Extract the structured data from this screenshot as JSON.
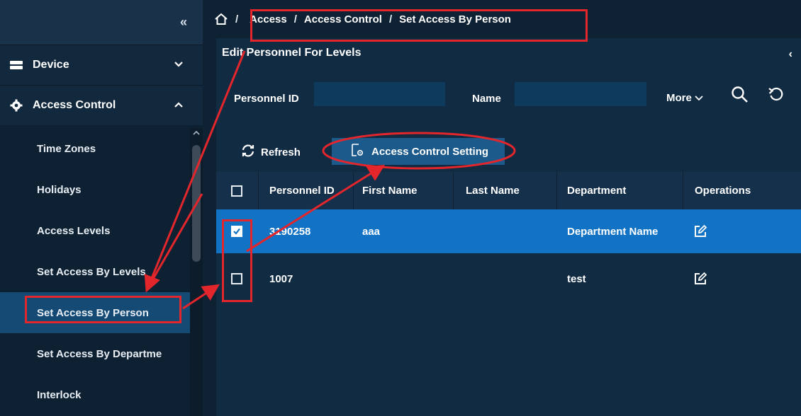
{
  "sidebar": {
    "collapse_glyph": "«",
    "groups": [
      {
        "label": "Device",
        "icon": "device-icon",
        "chevron": "˅"
      },
      {
        "label": "Access Control",
        "icon": "gear-icon",
        "chevron": "˄"
      }
    ],
    "items": [
      {
        "label": "Time Zones"
      },
      {
        "label": "Holidays"
      },
      {
        "label": "Access Levels"
      },
      {
        "label": "Set Access By Levels"
      },
      {
        "label": "Set Access By Person"
      },
      {
        "label": "Set Access By Departme"
      },
      {
        "label": "Interlock"
      }
    ],
    "active_item": "Set Access By Person"
  },
  "breadcrumb": {
    "separator": "/",
    "items": [
      "Access",
      "Access Control",
      "Set Access By Person"
    ]
  },
  "panel": {
    "title": "Edit Personnel For Levels",
    "collapse_glyph": "‹"
  },
  "filters": {
    "personnel_id_label": "Personnel ID",
    "personnel_id_value": "",
    "name_label": "Name",
    "name_value": "",
    "more_label": "More"
  },
  "toolbar": {
    "refresh_label": "Refresh",
    "access_control_setting_label": "Access Control Setting"
  },
  "table": {
    "columns": [
      "Personnel ID",
      "First Name",
      "Last Name",
      "Department",
      "Operations"
    ],
    "rows": [
      {
        "checked": true,
        "personnel_id": "3190258",
        "first_name": "aaa",
        "last_name": "",
        "department": "Department Name"
      },
      {
        "checked": false,
        "personnel_id": "1007",
        "first_name": "",
        "last_name": "",
        "department": "test"
      }
    ]
  },
  "colors": {
    "background": "#0f2234",
    "sidebar_active": "#154a75",
    "row_selected": "#1272c4",
    "annotation": "#e3262b"
  }
}
